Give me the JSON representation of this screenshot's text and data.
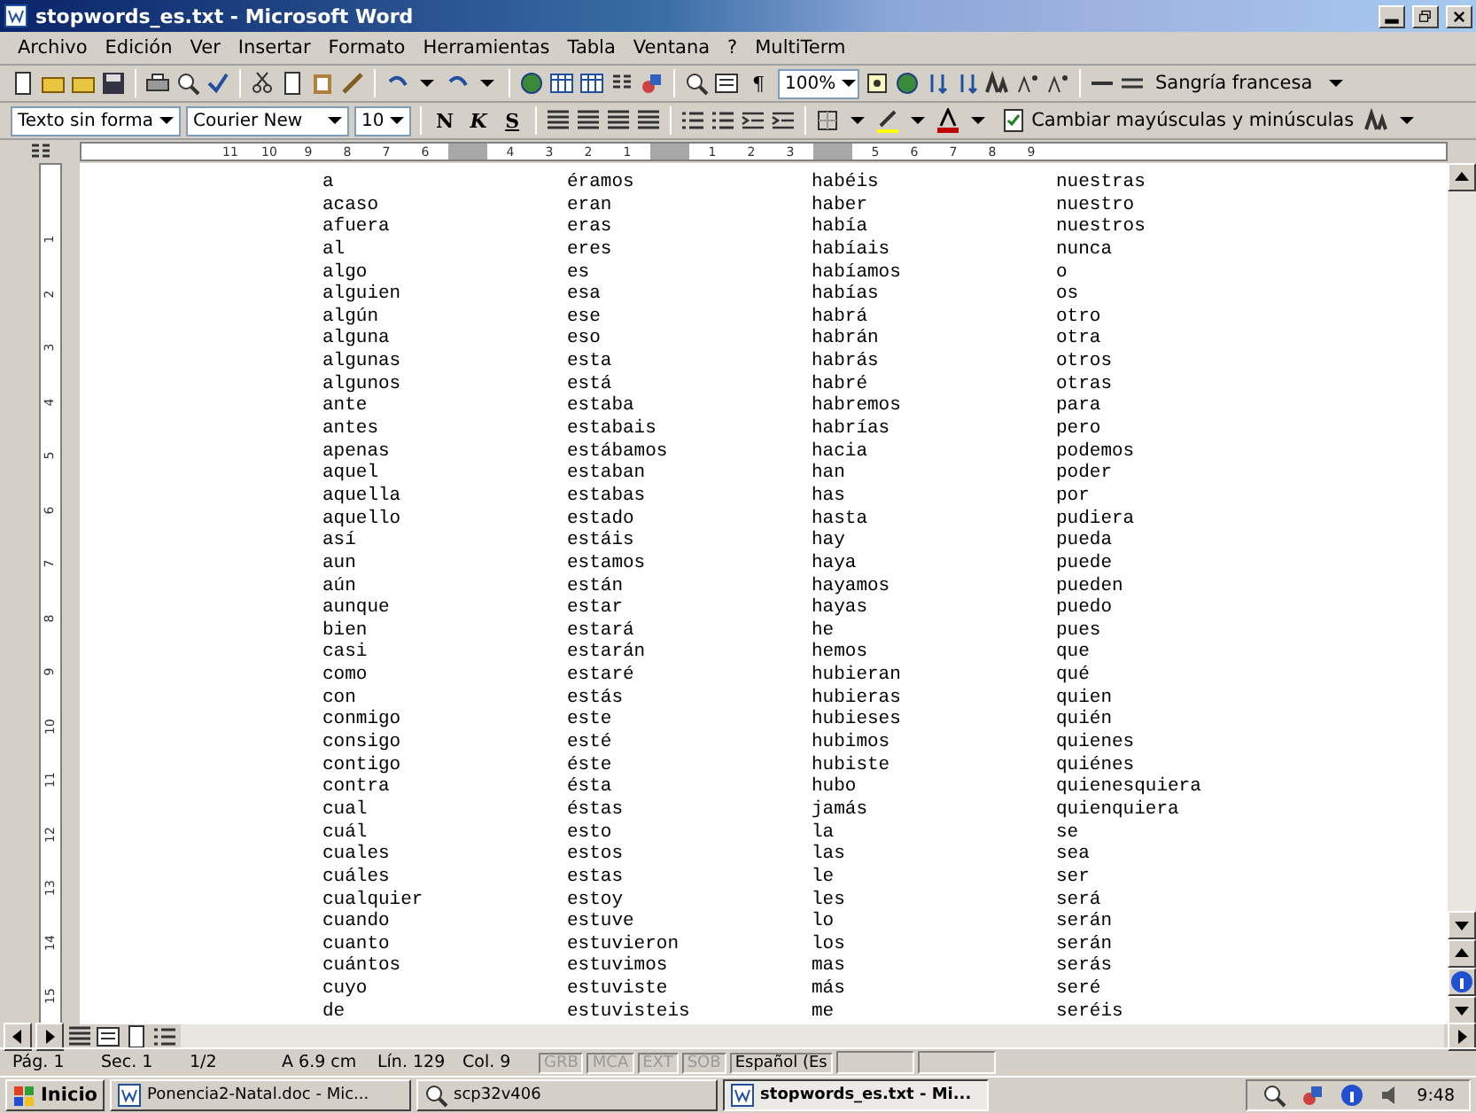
{
  "window": {
    "title": "stopwords_es.txt - Microsoft Word"
  },
  "menu": [
    "Archivo",
    "Edición",
    "Ver",
    "Insertar",
    "Formato",
    "Herramientas",
    "Tabla",
    "Ventana",
    "?",
    "MultiTerm"
  ],
  "toolbar_standard": {
    "pilcrow": "¶",
    "zoom": "100%",
    "style_box": "Sangría francesa"
  },
  "toolbar_format": {
    "style": "Texto sin forma",
    "font": "Courier New",
    "size": "10",
    "bold": "N",
    "italic": "K",
    "underline": "S",
    "change_case": "Cambiar mayúsculas y minúsculas"
  },
  "ruler": [
    {
      "kind": "numbers",
      "labels": [
        "11",
        "10",
        "9",
        "8",
        "7",
        "6"
      ]
    },
    {
      "kind": "gap"
    },
    {
      "kind": "numbers",
      "labels": [
        "4",
        "3",
        "2",
        "1"
      ]
    },
    {
      "kind": "gap"
    },
    {
      "kind": "numbers",
      "labels": [
        "1",
        "2",
        "3"
      ]
    },
    {
      "kind": "gap"
    },
    {
      "kind": "numbers",
      "labels": [
        "5",
        "6",
        "7",
        "8",
        "9"
      ]
    }
  ],
  "vertical_ruler": [
    "1",
    "2",
    "3",
    "4",
    "5",
    "6",
    "7",
    "8",
    "9",
    "10",
    "11",
    "12",
    "13",
    "14",
    "15"
  ],
  "document": {
    "columns": [
      [
        "a",
        "acaso",
        "afuera",
        "al",
        "algo",
        "alguien",
        "algún",
        "alguna",
        "algunas",
        "algunos",
        "ante",
        "antes",
        "apenas",
        "aquel",
        "aquella",
        "aquello",
        "así",
        "aun",
        "aún",
        "aunque",
        "bien",
        "casi",
        "como",
        "con",
        "conmigo",
        "consigo",
        "contigo",
        "contra",
        "cual",
        "cuál",
        "cuales",
        "cuáles",
        "cualquier",
        "cuando",
        "cuanto",
        "cuántos",
        "cuyo",
        "de"
      ],
      [
        "éramos",
        "eran",
        "eras",
        "eres",
        "es",
        "esa",
        "ese",
        "eso",
        "esta",
        "está",
        "estaba",
        "estabais",
        "estábamos",
        "estaban",
        "estabas",
        "estado",
        "estáis",
        "estamos",
        "están",
        "estar",
        "estará",
        "estarán",
        "estaré",
        "estás",
        "este",
        "esté",
        "éste",
        "ésta",
        "éstas",
        "esto",
        "estos",
        "estas",
        "estoy",
        "estuve",
        "estuvieron",
        "estuvimos",
        "estuviste",
        "estuvisteis"
      ],
      [
        "habéis",
        "haber",
        "había",
        "habíais",
        "habíamos",
        "habías",
        "habrá",
        "habrán",
        "habrás",
        "habré",
        "habremos",
        "habrías",
        "hacia",
        "han",
        "has",
        "hasta",
        "hay",
        "haya",
        "hayamos",
        "hayas",
        "he",
        "hemos",
        "hubieran",
        "hubieras",
        "hubieses",
        "hubimos",
        "hubiste",
        "hubo",
        "jamás",
        "la",
        "las",
        "le",
        "les",
        "lo",
        "los",
        "mas",
        "más",
        "me"
      ],
      [
        "nuestras",
        "nuestro",
        "nuestros",
        "nunca",
        "o",
        "os",
        "otro",
        "otra",
        "otros",
        "otras",
        "para",
        "pero",
        "podemos",
        "poder",
        "por",
        "pudiera",
        "pueda",
        "puede",
        "pueden",
        "puedo",
        "pues",
        "que",
        "qué",
        "quien",
        "quién",
        "quienes",
        "quiénes",
        "quienesquiera",
        "quienquiera",
        "se",
        "sea",
        "ser",
        "será",
        "serán",
        "serán",
        "serás",
        "seré",
        "seréis"
      ]
    ]
  },
  "status_bar": {
    "fields": [
      "Pág. 1",
      "Sec. 1",
      "1/2",
      "A 6.9 cm",
      "Lín. 129",
      "Col. 9"
    ],
    "modes": [
      {
        "label": "GRB",
        "disabled": true
      },
      {
        "label": "MCA",
        "disabled": true
      },
      {
        "label": "EXT",
        "disabled": true
      },
      {
        "label": "SOB",
        "disabled": true
      },
      {
        "label": "Español (Es",
        "disabled": false
      }
    ]
  },
  "taskbar": {
    "start": "Inicio",
    "tasks": [
      {
        "label": "Ponencia2-Natal.doc - Mic...",
        "selected": false
      },
      {
        "label": "scp32v406",
        "selected": false
      },
      {
        "label": "stopwords_es.txt - Mi...",
        "selected": true
      }
    ],
    "time": "9:48"
  }
}
